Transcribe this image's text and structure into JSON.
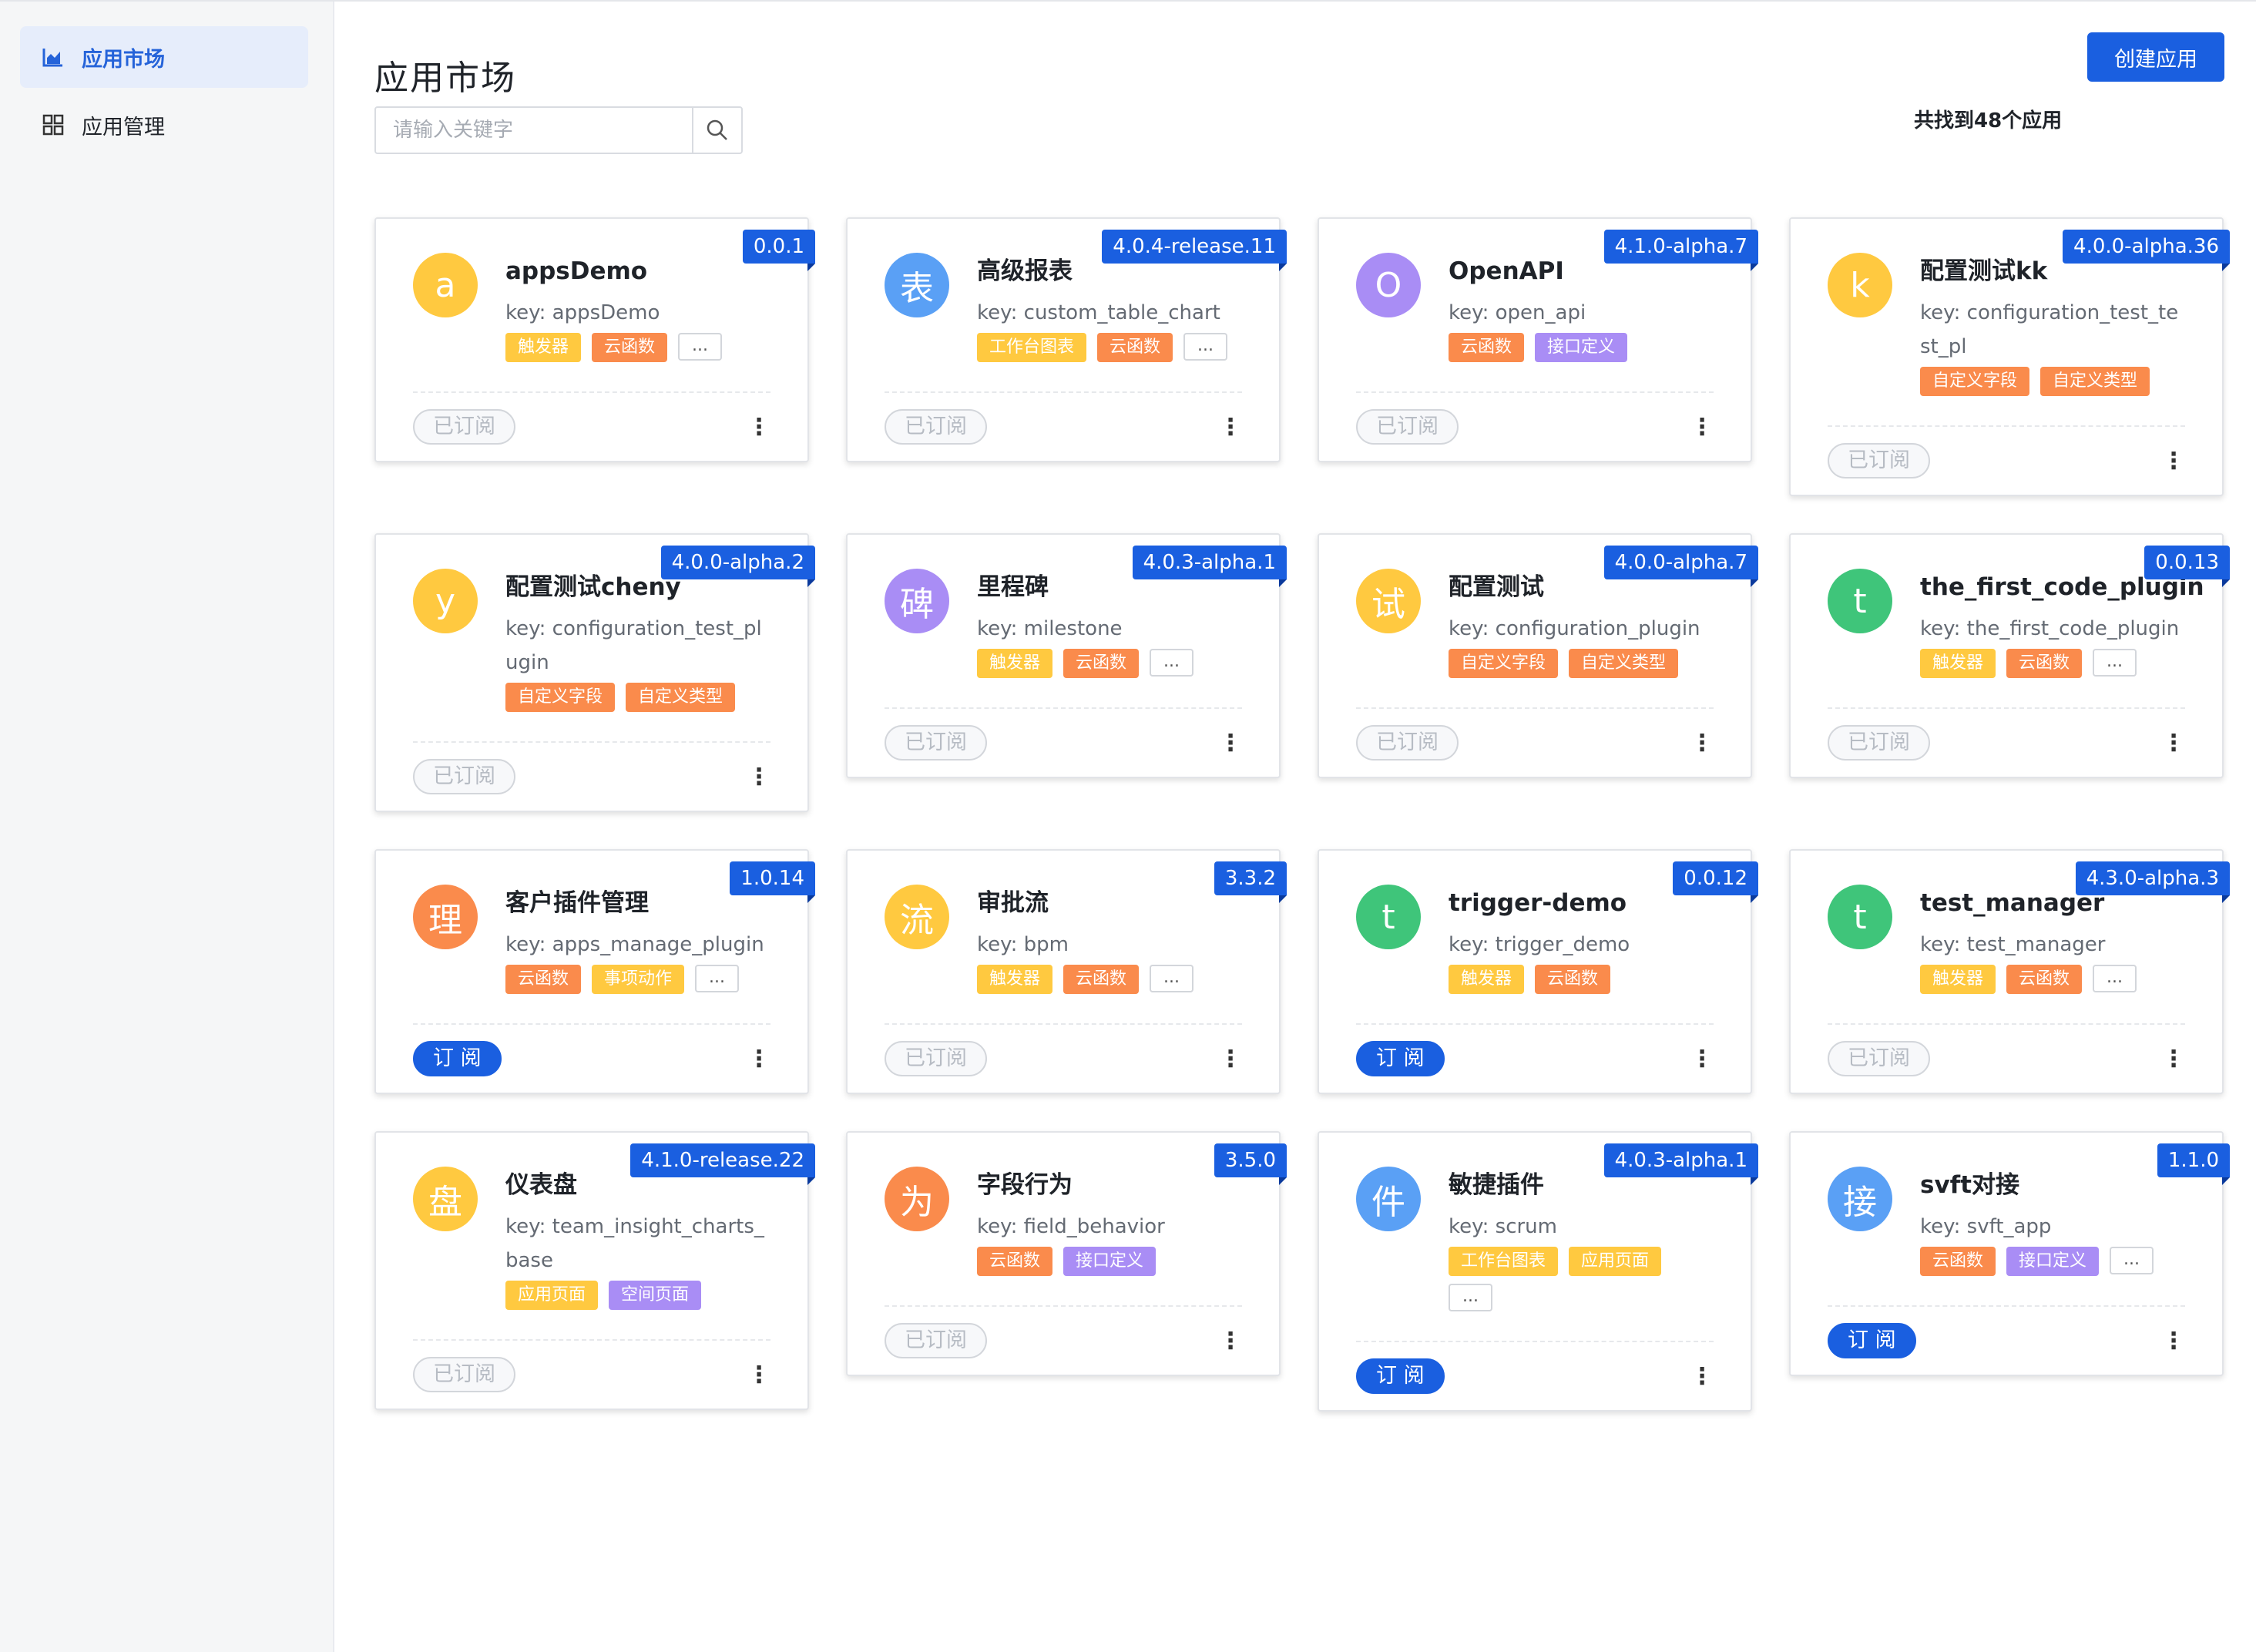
{
  "sidebar": {
    "items": [
      {
        "label": "应用市场",
        "icon": "chart-icon",
        "active": true
      },
      {
        "label": "应用管理",
        "icon": "grid-icon",
        "active": false
      }
    ]
  },
  "header": {
    "title": "应用市场",
    "create_label": "创建应用",
    "search_placeholder": "请输入关键字",
    "result_count": "共找到48个应用"
  },
  "colors": {
    "accent": "#1a5fe0",
    "yellow": "#ffc940",
    "blue": "#5aa0f5",
    "purple": "#a98df5",
    "green": "#3fc57a",
    "orange": "#fa8b4c"
  },
  "tag_colors": {
    "触发器": "#ffc940",
    "云函数": "#fa8b4c",
    "工作台图表": "#ffc940",
    "接口定义": "#a98df5",
    "自定义字段": "#fa8b4c",
    "自定义类型": "#fa8b4c",
    "事项动作": "#ffc940",
    "应用页面": "#ffc940",
    "空间页面": "#a98df5",
    "...": "more"
  },
  "cards": [
    {
      "avatar": "a",
      "avatar_color": "#ffc940",
      "name": "appsDemo",
      "key": "key: appsDemo",
      "version": "0.0.1",
      "tags": [
        "触发器",
        "云函数",
        "..."
      ],
      "status": "已订阅",
      "subscribed": true
    },
    {
      "avatar": "表",
      "avatar_color": "#5aa0f5",
      "name": "高级报表",
      "key": "key: custom_table_chart",
      "version": "4.0.4-release.11",
      "tags": [
        "工作台图表",
        "云函数",
        "..."
      ],
      "status": "已订阅",
      "subscribed": true
    },
    {
      "avatar": "O",
      "avatar_color": "#a98df5",
      "name": "OpenAPI",
      "key": "key: open_api",
      "version": "4.1.0-alpha.7",
      "tags": [
        "云函数",
        "接口定义"
      ],
      "status": "已订阅",
      "subscribed": true
    },
    {
      "avatar": "k",
      "avatar_color": "#ffc940",
      "name": "配置测试kk",
      "key": "key: configuration_test_test_pl",
      "version": "4.0.0-alpha.36",
      "tags": [
        "自定义字段",
        "自定义类型"
      ],
      "status": "已订阅",
      "subscribed": true
    },
    {
      "avatar": "y",
      "avatar_color": "#ffc940",
      "name": "配置测试cheny",
      "key": "key: configuration_test_plugin",
      "version": "4.0.0-alpha.2",
      "tags": [
        "自定义字段",
        "自定义类型"
      ],
      "status": "已订阅",
      "subscribed": true
    },
    {
      "avatar": "碑",
      "avatar_color": "#a98df5",
      "name": "里程碑",
      "key": "key: milestone",
      "version": "4.0.3-alpha.1",
      "tags": [
        "触发器",
        "云函数",
        "..."
      ],
      "status": "已订阅",
      "subscribed": true
    },
    {
      "avatar": "试",
      "avatar_color": "#ffc940",
      "name": "配置测试",
      "key": "key: configuration_plugin",
      "version": "4.0.0-alpha.7",
      "tags": [
        "自定义字段",
        "自定义类型"
      ],
      "status": "已订阅",
      "subscribed": true
    },
    {
      "avatar": "t",
      "avatar_color": "#3fc57a",
      "name": "the_first_code_plugin",
      "key": "key: the_first_code_plugin",
      "version": "0.0.13",
      "tags": [
        "触发器",
        "云函数",
        "..."
      ],
      "status": "已订阅",
      "subscribed": true
    },
    {
      "avatar": "理",
      "avatar_color": "#fa8b4c",
      "name": "客户插件管理",
      "key": "key: apps_manage_plugin",
      "version": "1.0.14",
      "tags": [
        "云函数",
        "事项动作",
        "..."
      ],
      "status": "订 阅",
      "subscribed": false
    },
    {
      "avatar": "流",
      "avatar_color": "#ffc940",
      "name": "审批流",
      "key": "key: bpm",
      "version": "3.3.2",
      "tags": [
        "触发器",
        "云函数",
        "..."
      ],
      "status": "已订阅",
      "subscribed": true
    },
    {
      "avatar": "t",
      "avatar_color": "#3fc57a",
      "name": "trigger-demo",
      "key": "key: trigger_demo",
      "version": "0.0.12",
      "tags": [
        "触发器",
        "云函数"
      ],
      "status": "订 阅",
      "subscribed": false
    },
    {
      "avatar": "t",
      "avatar_color": "#3fc57a",
      "name": "test_manager",
      "key": "key: test_manager",
      "version": "4.3.0-alpha.3",
      "tags": [
        "触发器",
        "云函数",
        "..."
      ],
      "status": "已订阅",
      "subscribed": true
    },
    {
      "avatar": "盘",
      "avatar_color": "#ffc940",
      "name": "仪表盘",
      "key": "key: team_insight_charts_base",
      "version": "4.1.0-release.22",
      "tags": [
        "应用页面",
        "空间页面"
      ],
      "status": "已订阅",
      "subscribed": true
    },
    {
      "avatar": "为",
      "avatar_color": "#fa8b4c",
      "name": "字段行为",
      "key": "key: field_behavior",
      "version": "3.5.0",
      "tags": [
        "云函数",
        "接口定义"
      ],
      "status": "已订阅",
      "subscribed": true
    },
    {
      "avatar": "件",
      "avatar_color": "#5aa0f5",
      "name": "敏捷插件",
      "key": "key: scrum",
      "version": "4.0.3-alpha.1",
      "tags": [
        "工作台图表",
        "应用页面",
        "..."
      ],
      "status": "订 阅",
      "subscribed": false
    },
    {
      "avatar": "接",
      "avatar_color": "#5aa0f5",
      "name": "svft对接",
      "key": "key: svft_app",
      "version": "1.1.0",
      "tags": [
        "云函数",
        "接口定义",
        "..."
      ],
      "status": "订 阅",
      "subscribed": false
    }
  ]
}
